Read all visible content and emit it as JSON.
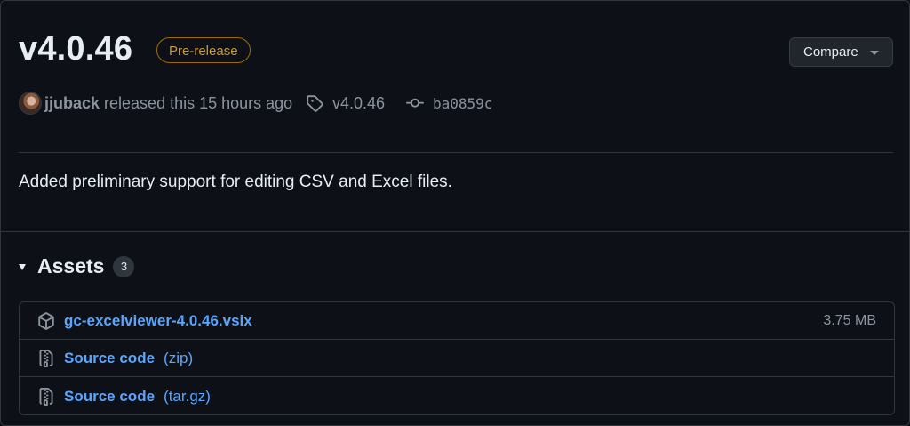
{
  "release": {
    "title": "v4.0.46",
    "badge": "Pre-release",
    "compare_label": "Compare",
    "author": "jjuback",
    "released_text": "released this 15 hours ago",
    "tag": "v4.0.46",
    "commit": "ba0859c",
    "description": "Added preliminary support for editing CSV and Excel files."
  },
  "assets": {
    "title": "Assets",
    "count": "3",
    "items": [
      {
        "name": "gc-excelviewer-4.0.46.vsix",
        "size": "3.75 MB",
        "icon": "package-icon"
      },
      {
        "name": "Source code",
        "suffix": "(zip)",
        "icon": "file-zip-icon"
      },
      {
        "name": "Source code",
        "suffix": "(tar.gz)",
        "icon": "file-zip-icon"
      }
    ]
  },
  "colors": {
    "background": "#0d1117",
    "border": "#30363d",
    "link": "#58a6ff",
    "muted": "#8b949e",
    "prerelease": "#d29922"
  }
}
